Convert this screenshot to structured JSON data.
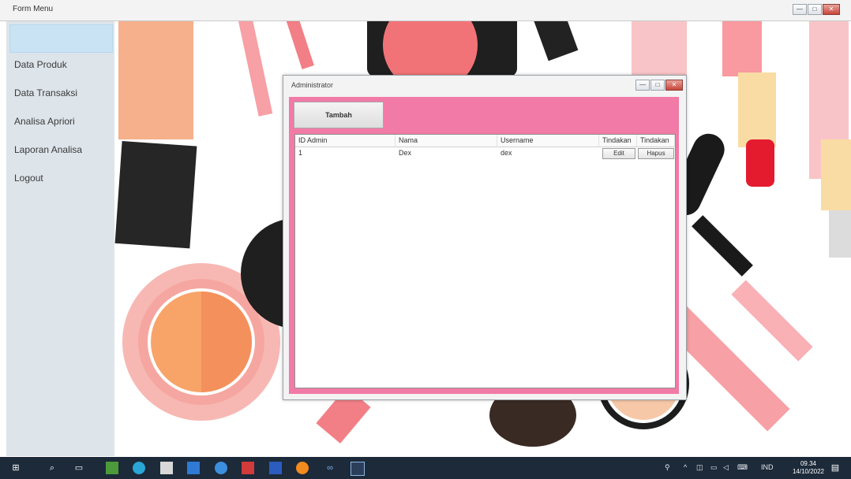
{
  "window": {
    "title": "Form Menu",
    "buttons": {
      "minimize": "—",
      "maximize": "□",
      "close": "✕"
    }
  },
  "sidebar": {
    "items": [
      {
        "label": ""
      },
      {
        "label": "Data Produk"
      },
      {
        "label": "Data Transaksi"
      },
      {
        "label": "Analisa Apriori"
      },
      {
        "label": "Laporan Analisa"
      },
      {
        "label": "Logout"
      }
    ]
  },
  "dialog": {
    "title": "Administrator",
    "tambah_label": "Tambah",
    "columns": [
      "ID Admin",
      "Nama",
      "Username",
      "Tindakan",
      "Tindakan"
    ],
    "rows": [
      {
        "id": "1",
        "nama": "Dex",
        "username": "dex",
        "edit": "Edit",
        "hapus": "Hapus"
      }
    ]
  },
  "taskbar": {
    "clock_time": "09.34",
    "clock_date": "14/10/2022",
    "lang": "IND"
  },
  "colors": {
    "dialog_bg": "#f17aa6",
    "sidebar_bg": "#dde4ea",
    "taskbar": "#1c2a3a"
  }
}
